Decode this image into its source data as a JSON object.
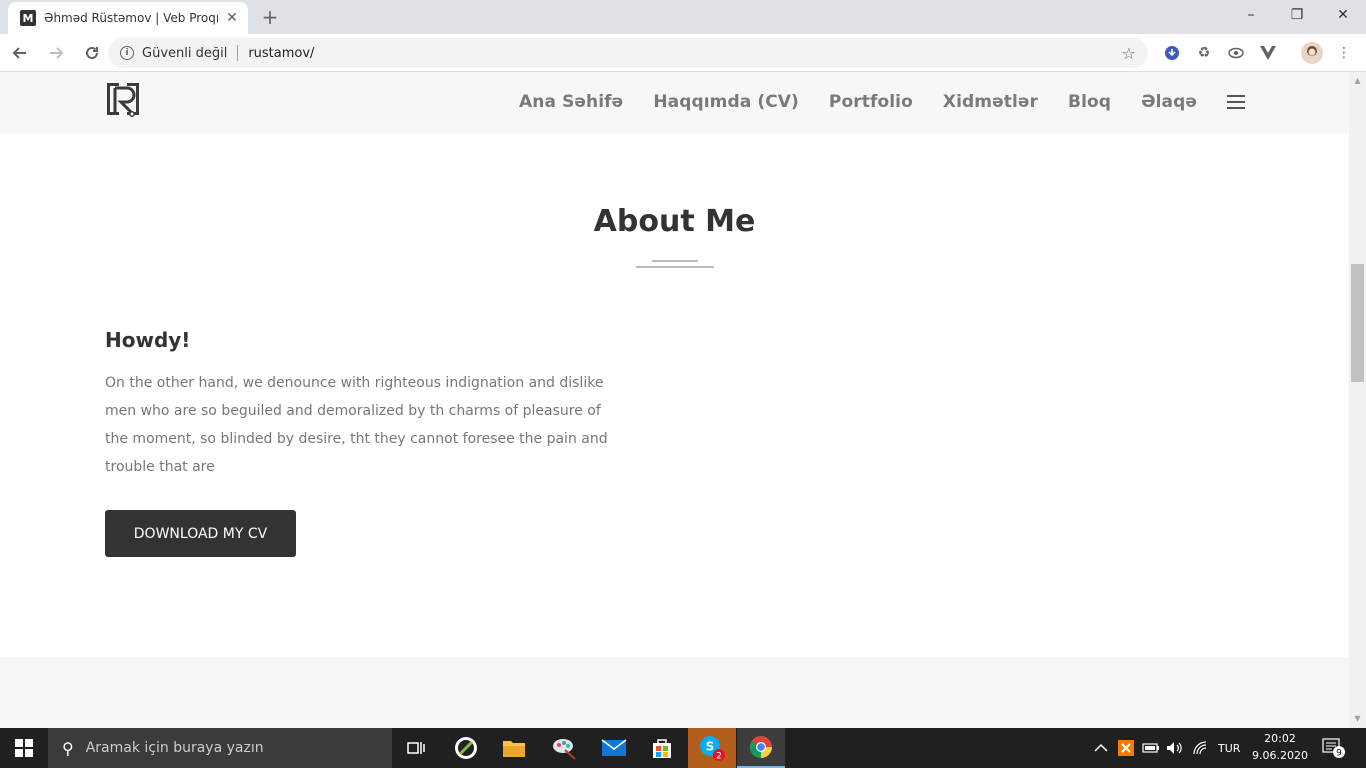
{
  "browser": {
    "tab_title": "Əhməd Rüstəmov | Veb Proqram",
    "tab_favicon_letter": "M",
    "security_label": "Güvenli değil",
    "url": "rustamov/"
  },
  "nav": {
    "items": [
      "Ana Səhifə",
      "Haqqımda (CV)",
      "Portfolio",
      "Xidmətlər",
      "Bloq",
      "Əlaqə"
    ]
  },
  "about": {
    "title": "About Me",
    "greeting": "Howdy!",
    "body": "On the other hand, we denounce with righteous indignation and dislike men who are so beguiled and demoralized by th charms of pleasure of the moment, so blinded by desire, tht they cannot foresee the pain and trouble that are",
    "cv_button": "DOWNLOAD MY CV"
  },
  "taskbar": {
    "search_placeholder": "Aramak için buraya yazın",
    "skype_badge": "2",
    "language": "TUR",
    "time": "20:02",
    "date": "9.06.2020",
    "notifications": "9"
  },
  "colors": {
    "heading": "#333333",
    "nav_text": "#7a7a7a",
    "body_text": "#777777",
    "button_bg": "#333333",
    "navbar_bg": "#f7f7f7"
  }
}
